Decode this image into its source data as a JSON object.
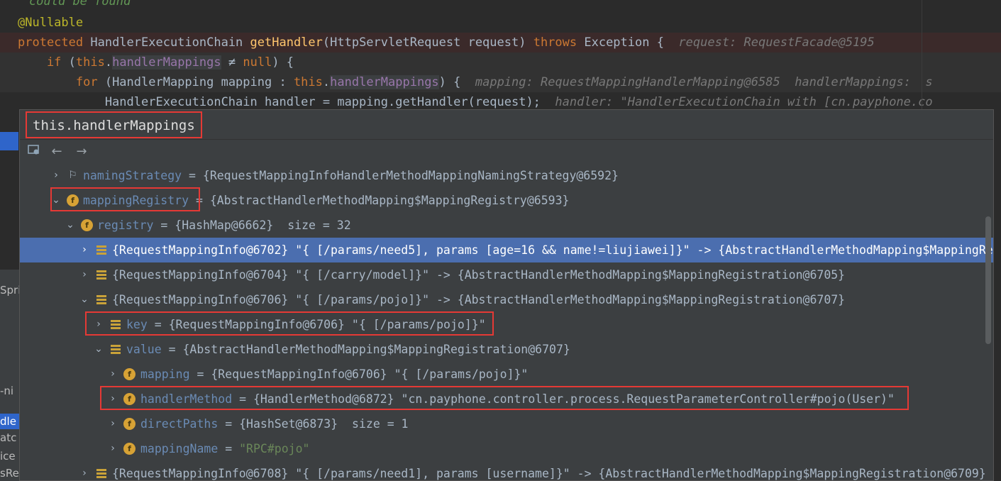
{
  "code": {
    "line0": "    could be found",
    "line1_ann": "@Nullable",
    "line2": {
      "kw": "protected ",
      "type": "HandlerExecutionChain ",
      "fn": "getHandler",
      "params": "(HttpServletRequest request) ",
      "throws": "throws ",
      "exc": "Exception {",
      "hint": "  request: RequestFacade@5195"
    },
    "line3": {
      "kw": "    if ",
      "open": "(",
      "this": "this",
      "dot": ".",
      "field": "handlerMappings",
      "rest": " ≠ ",
      "null": "null",
      "close": ") {"
    },
    "line4": {
      "kw": "        for ",
      "mid": "(HandlerMapping mapping : ",
      "this": "this",
      "dot": ".",
      "field": "handlerMappings",
      "close": ") {",
      "hint": "  mapping: RequestMappingHandlerMapping@6585  handlerMappings:  s"
    },
    "line5": {
      "code": "            HandlerExecutionChain handler = mapping.getHandler(request);",
      "hint": "  handler: \"HandlerExecutionChain with [cn.payphone.co"
    }
  },
  "left_panel": [
    "Spri",
    "-ni",
    "dle",
    "atc",
    "ice",
    "sRe"
  ],
  "popup": {
    "title": "this.handlerMappings",
    "toolbar": {
      "view_icon": "view-icon",
      "back": "←",
      "forward": "→"
    },
    "rows": [
      {
        "name": "namingStrategy",
        "value": " = {RequestMappingInfoHandlerMethodMappingNamingStrategy@6592}"
      },
      {
        "name": "mappingRegistry",
        "value": " = {AbstractHandlerMethodMapping$MappingRegistry@6593}"
      },
      {
        "name": "registry",
        "value": " = {HashMap@6662}  size = 32"
      },
      {
        "value": "{RequestMappingInfo@6702} \"{ [/params/need5], params [age=16 && name!=liujiawei]}\" -> {AbstractHandlerMethodMapping$MappingRe"
      },
      {
        "value": "{RequestMappingInfo@6704} \"{ [/carry/model]}\" -> {AbstractHandlerMethodMapping$MappingRegistration@6705}"
      },
      {
        "value": "{RequestMappingInfo@6706} \"{ [/params/pojo]}\" -> {AbstractHandlerMethodMapping$MappingRegistration@6707}"
      },
      {
        "name": "key",
        "value": " = {RequestMappingInfo@6706} \"{ [/params/pojo]}\""
      },
      {
        "name": "value",
        "value": " = {AbstractHandlerMethodMapping$MappingRegistration@6707}"
      },
      {
        "name": "mapping",
        "value": " = {RequestMappingInfo@6706} \"{ [/params/pojo]}\""
      },
      {
        "name": "handlerMethod",
        "value": " = {HandlerMethod@6872} \"cn.payphone.controller.process.RequestParameterController#pojo(User)\""
      },
      {
        "name": "directPaths",
        "value": " = {HashSet@6873}  size = 1"
      },
      {
        "name": "mappingName",
        "eq": " = ",
        "value": "\"RPC#pojo\""
      },
      {
        "value": "{RequestMappingInfo@6708} \"{ [/params/need1], params [username]}\" -> {AbstractHandlerMethodMapping$MappingRegistration@6709}"
      }
    ]
  },
  "colors": {
    "accent_selection": "#4b6eaf",
    "annotation_box": "#e53935",
    "field_icon": "#d7a235"
  }
}
